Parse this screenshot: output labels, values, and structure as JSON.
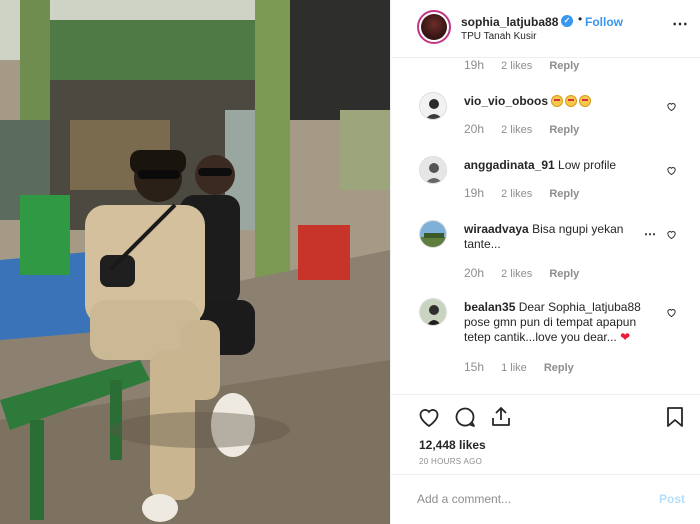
{
  "post": {
    "username": "sophia_latjuba88",
    "location": "TPU Tanah Kusir",
    "follow_label": "Follow",
    "separator": "•"
  },
  "comments": [
    {
      "username": "",
      "text": "",
      "time": "19h",
      "likes": "2 likes",
      "reply": "Reply"
    },
    {
      "username": "vio_vio_oboos",
      "text": "",
      "emoji_count": 3,
      "time": "20h",
      "likes": "2 likes",
      "reply": "Reply"
    },
    {
      "username": "anggadinata_91",
      "text": "Low profile",
      "time": "19h",
      "likes": "2 likes",
      "reply": "Reply"
    },
    {
      "username": "wiraadvaya",
      "text": "Bisa ngupi yekan tante...",
      "time": "20h",
      "likes": "2 likes",
      "reply": "Reply"
    },
    {
      "username": "bealan35",
      "text": "Dear Sophia_latjuba88 pose gmn pun di tempat apapun tetep cantik...love you dear...",
      "time": "15h",
      "likes": "1 like",
      "reply": "Reply"
    }
  ],
  "footer": {
    "likes": "12,448 likes",
    "time_ago": "20 HOURS AGO",
    "comment_placeholder": "Add a comment...",
    "post_label": "Post"
  },
  "colors": {
    "link_blue": "#3897f0",
    "muted_gray": "#8e8e8e",
    "post_disabled": "#b2dffc"
  }
}
